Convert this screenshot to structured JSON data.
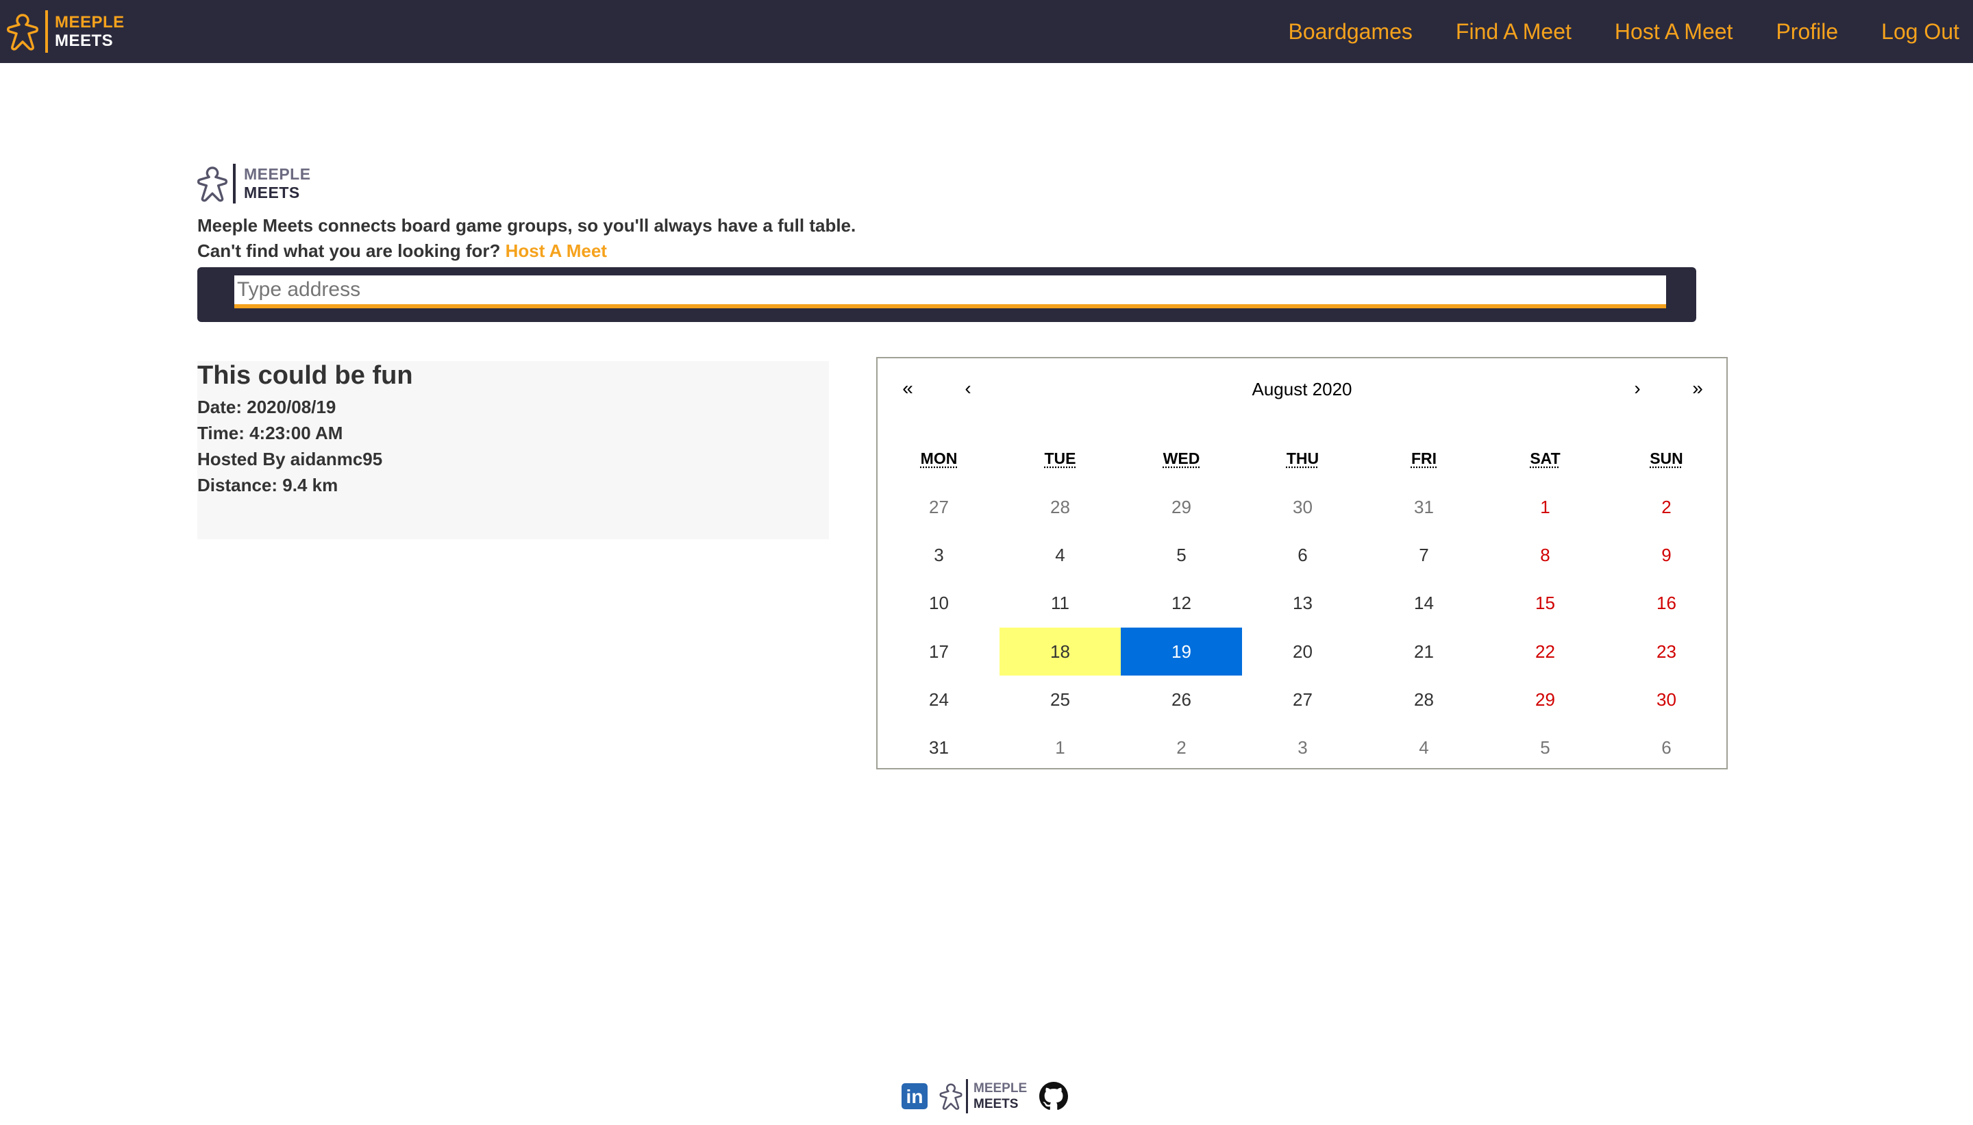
{
  "colors": {
    "navbar_bg": "#2b2a3d",
    "accent": "#f5a21c",
    "weekend": "#d10000",
    "today": "#ffff76",
    "active": "#006edc"
  },
  "logo": {
    "line1": "MEEPLE",
    "line2": "MEETS",
    "icon": "meeple-icon"
  },
  "nav": {
    "links": [
      "Boardgames",
      "Find A Meet",
      "Host A Meet",
      "Profile",
      "Log Out"
    ]
  },
  "hero": {
    "tagline": "Meeple Meets connects board game groups, so you'll always have a full table.",
    "cant_find": "Can't find what you are looking for?",
    "host_link": "Host A Meet"
  },
  "search": {
    "placeholder": "Type address",
    "value": ""
  },
  "meet": {
    "title": "This could be fun",
    "date": "Date: 2020/08/19",
    "time": "Time: 4:23:00 AM",
    "host": "Hosted By aidanmc95",
    "distance": "Distance: 9.4 km"
  },
  "calendar": {
    "label": "August 2020",
    "nav": {
      "prev2": "«",
      "prev": "‹",
      "next": "›",
      "next2": "»"
    },
    "weekdays": [
      "MON",
      "TUE",
      "WED",
      "THU",
      "FRI",
      "SAT",
      "SUN"
    ],
    "weeks": [
      [
        "27",
        "28",
        "29",
        "30",
        "31",
        "1",
        "2"
      ],
      [
        "3",
        "4",
        "5",
        "6",
        "7",
        "8",
        "9"
      ],
      [
        "10",
        "11",
        "12",
        "13",
        "14",
        "15",
        "16"
      ],
      [
        "17",
        "18",
        "19",
        "20",
        "21",
        "22",
        "23"
      ],
      [
        "24",
        "25",
        "26",
        "27",
        "28",
        "29",
        "30"
      ],
      [
        "31",
        "1",
        "2",
        "3",
        "4",
        "5",
        "6"
      ]
    ],
    "today": "18",
    "selected": "19"
  },
  "footer": {
    "icons": [
      "linkedin-icon",
      "meeple-meets-logo",
      "github-icon"
    ],
    "linkedin_text": "in"
  }
}
